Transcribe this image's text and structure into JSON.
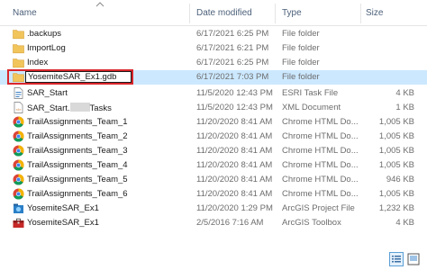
{
  "columns": {
    "name": "Name",
    "date_modified": "Date modified",
    "type": "Type",
    "size": "Size"
  },
  "rows": [
    {
      "name": ".backups",
      "date": "6/17/2021 6:25 PM",
      "type": "File folder",
      "size": "",
      "icon": "folder-icon"
    },
    {
      "name": "ImportLog",
      "date": "6/17/2021 6:21 PM",
      "type": "File folder",
      "size": "",
      "icon": "folder-icon"
    },
    {
      "name": "Index",
      "date": "6/17/2021 6:25 PM",
      "type": "File folder",
      "size": "",
      "icon": "folder-icon"
    },
    {
      "name": "YosemiteSAR_Ex1.gdb",
      "date": "6/17/2021 7:03 PM",
      "type": "File folder",
      "size": "",
      "icon": "folder-icon",
      "renaming": true
    },
    {
      "name": "SAR_Start",
      "date": "11/5/2020 12:43 PM",
      "type": "ESRI Task File",
      "size": "4 KB",
      "icon": "task-file-icon"
    },
    {
      "name_prefix": "SAR_Start.",
      "name_suffix": "Tasks",
      "date": "11/5/2020 12:43 PM",
      "type": "XML Document",
      "size": "1 KB",
      "icon": "xml-document-icon"
    },
    {
      "name": "TrailAssignments_Team_1",
      "date": "11/20/2020 8:41 AM",
      "type": "Chrome HTML Do...",
      "size": "1,005 KB",
      "icon": "chrome-icon"
    },
    {
      "name": "TrailAssignments_Team_2",
      "date": "11/20/2020 8:41 AM",
      "type": "Chrome HTML Do...",
      "size": "1,005 KB",
      "icon": "chrome-icon"
    },
    {
      "name": "TrailAssignments_Team_3",
      "date": "11/20/2020 8:41 AM",
      "type": "Chrome HTML Do...",
      "size": "1,005 KB",
      "icon": "chrome-icon"
    },
    {
      "name": "TrailAssignments_Team_4",
      "date": "11/20/2020 8:41 AM",
      "type": "Chrome HTML Do...",
      "size": "1,005 KB",
      "icon": "chrome-icon"
    },
    {
      "name": "TrailAssignments_Team_5",
      "date": "11/20/2020 8:41 AM",
      "type": "Chrome HTML Do...",
      "size": "946 KB",
      "icon": "chrome-icon"
    },
    {
      "name": "TrailAssignments_Team_6",
      "date": "11/20/2020 8:41 AM",
      "type": "Chrome HTML Do...",
      "size": "1,005 KB",
      "icon": "chrome-icon"
    },
    {
      "name": "YosemiteSAR_Ex1",
      "date": "11/20/2020 1:29 PM",
      "type": "ArcGIS Project File",
      "size": "1,232 KB",
      "icon": "arcgis-project-icon"
    },
    {
      "name": "YosemiteSAR_Ex1",
      "date": "2/5/2016 7:16 AM",
      "type": "ArcGIS Toolbox",
      "size": "4 KB",
      "icon": "arcgis-toolbox-icon"
    }
  ],
  "colors": {
    "selection": "#cce8ff",
    "rename_highlight": "#d9262b",
    "folder": "#e8b74a"
  }
}
